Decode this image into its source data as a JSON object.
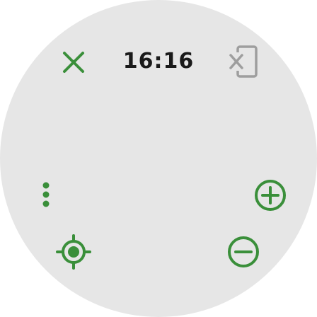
{
  "status": {
    "time": "16:16"
  },
  "icons": {
    "close": "close-icon",
    "phone_disconnected": "phone-disconnected-icon",
    "more": "more-vertical-icon",
    "zoom_in": "zoom-in-icon",
    "my_location": "my-location-icon",
    "zoom_out": "zoom-out-icon"
  },
  "colors": {
    "accent": "#3a8f3a",
    "muted": "#9e9e9e",
    "background": "#e6e6e6",
    "text": "#1a1a1a"
  }
}
